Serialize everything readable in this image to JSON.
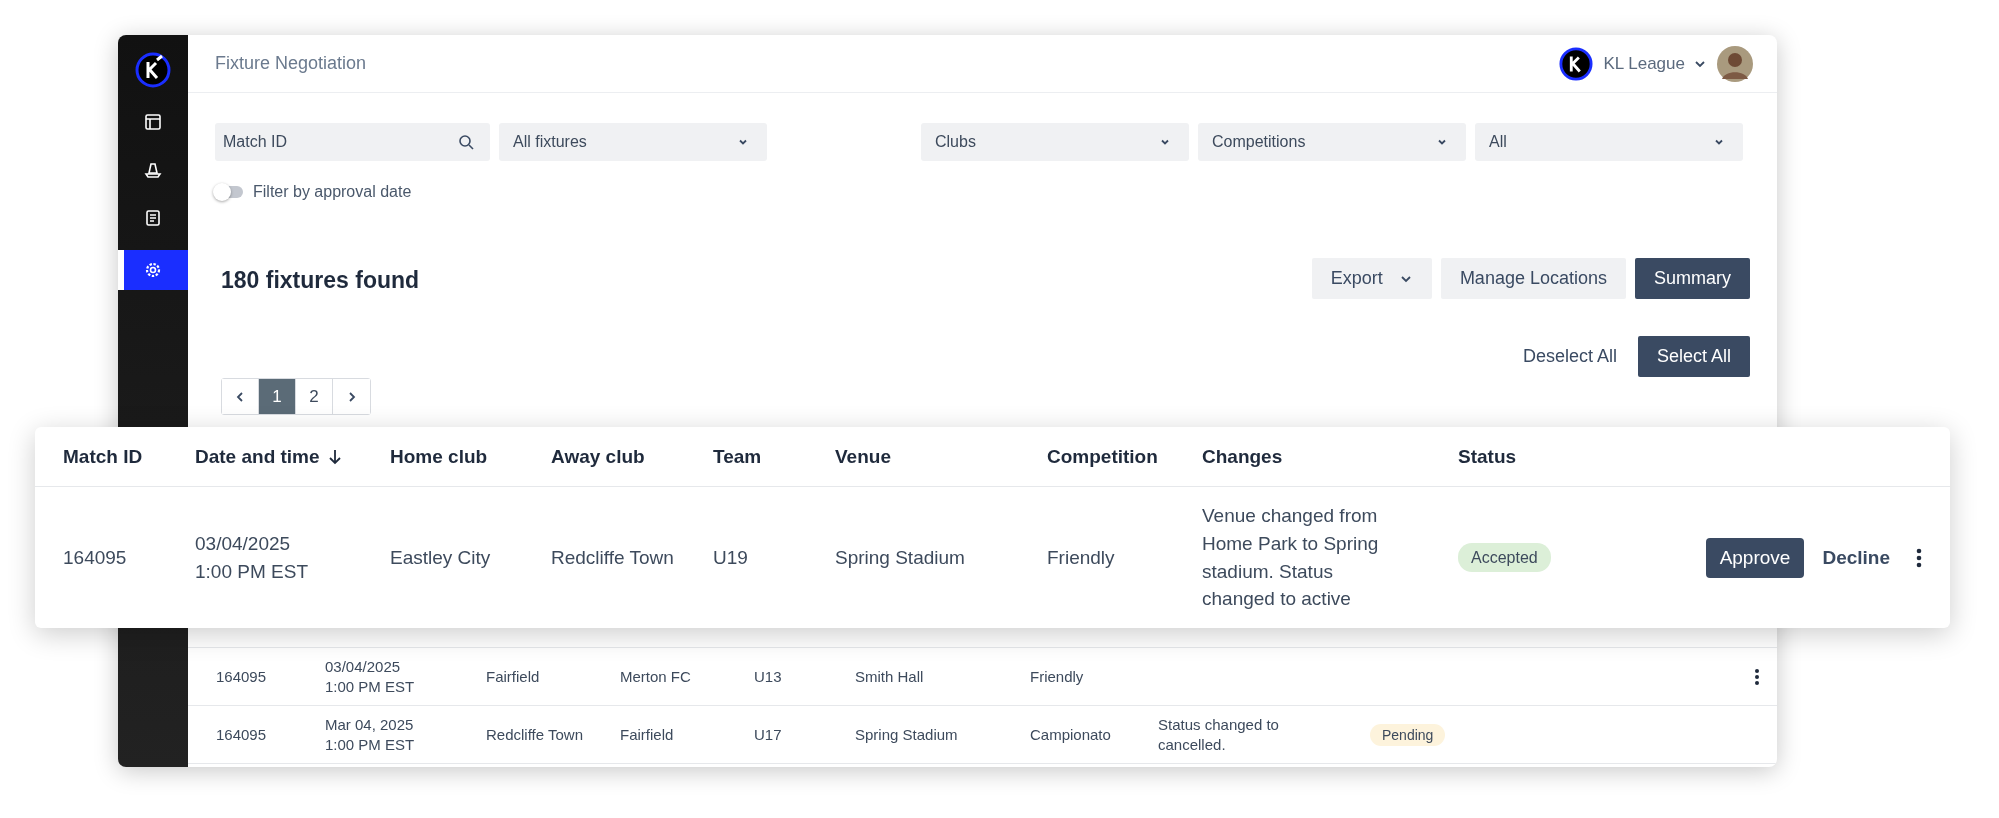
{
  "sidebar": {
    "items": [
      {
        "kind": "layout",
        "selected": false
      },
      {
        "kind": "cone",
        "selected": false
      },
      {
        "kind": "document",
        "selected": false
      },
      {
        "kind": "settings",
        "selected": true
      }
    ]
  },
  "header": {
    "title": "Fixture Negotiation",
    "organisation": "KL League"
  },
  "filters": {
    "search": {
      "placeholder": "Match ID"
    },
    "dropdowns": [
      "All fixtures",
      "Clubs",
      "Competitions",
      "All"
    ],
    "toggle": {
      "label": "Filter by approval date",
      "on": false
    }
  },
  "results": "180 fixtures found",
  "actions": [
    {
      "label": "Export",
      "kind": "menu"
    },
    {
      "label": "Manage Locations",
      "kind": "secondary"
    },
    {
      "label": "Summary",
      "kind": "primary"
    }
  ],
  "selection": [
    {
      "label": "Deselect All",
      "kind": "text"
    },
    {
      "label": "Select All",
      "kind": "primary"
    }
  ],
  "pagination": {
    "pages": [
      {
        "label": "1",
        "selected": true
      },
      {
        "label": "2",
        "selected": false
      }
    ]
  },
  "featured": {
    "columns": [
      {
        "label": "Match ID",
        "sorted": false
      },
      {
        "label": "Date and time",
        "sorted": true
      },
      {
        "label": "Home club",
        "sorted": false
      },
      {
        "label": "Away club",
        "sorted": false
      },
      {
        "label": "Team",
        "sorted": false
      },
      {
        "label": "Venue",
        "sorted": false
      },
      {
        "label": "Competition",
        "sorted": false
      },
      {
        "label": "Changes",
        "sorted": false
      },
      {
        "label": "Status",
        "sorted": false
      }
    ],
    "row": {
      "match_id": "164095",
      "date": "03/04/2025",
      "time": "1:00 PM EST",
      "home": "Eastley City",
      "away": "Redcliffe Town",
      "team": "U19",
      "venue": "Spring Stadium",
      "competition": "Friendly",
      "changes": "Venue changed from Home Park to Spring stadium. Status changed to active",
      "status": {
        "label": "Accepted",
        "color": "#dcefd8"
      },
      "actions": [
        "Approve",
        "Decline"
      ],
      "menu": true
    }
  },
  "table": {
    "rows": [
      {
        "match_id": "164095",
        "date": "03/04/2025",
        "time": "1:00 PM EST",
        "home": "Fairfield",
        "away": "Merton FC",
        "team": "U13",
        "venue": "Smith Hall",
        "competition": "Friendly",
        "menu": true
      },
      {
        "match_id": "164095",
        "date": "Mar 04, 2025",
        "time": "1:00 PM EST",
        "home": "Redcliffe Town",
        "away": "Fairfield",
        "team": "U17",
        "venue": "Spring Stadium",
        "competition": "Campionato",
        "changes": "Status changed to cancelled.",
        "status": {
          "label": "Pending",
          "color": "#fdf3dc"
        },
        "menu": false
      }
    ]
  }
}
